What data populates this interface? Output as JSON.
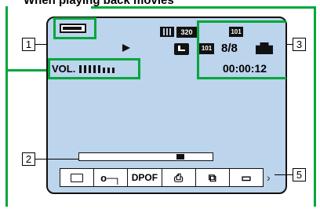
{
  "title": "When playing back movies",
  "callouts": {
    "c1": "1",
    "c2": "2",
    "c3": "3",
    "c5": "5"
  },
  "screen": {
    "movie_size": "320",
    "folder_label": "101",
    "folder_label2": "101",
    "image_count": "8/8",
    "timecode": "00:00:12",
    "volume_label": "VOL."
  },
  "menu": {
    "item1_icon": "folder-icon",
    "item2_icon": "protect-key-icon",
    "item3": "DPOF",
    "item4_icon": "print-icon",
    "item5_icon": "rotate-icon",
    "item6_icon": "resize-icon"
  },
  "colors": {
    "highlight": "#00a73c",
    "screen_bg": "#bcd4ec"
  }
}
